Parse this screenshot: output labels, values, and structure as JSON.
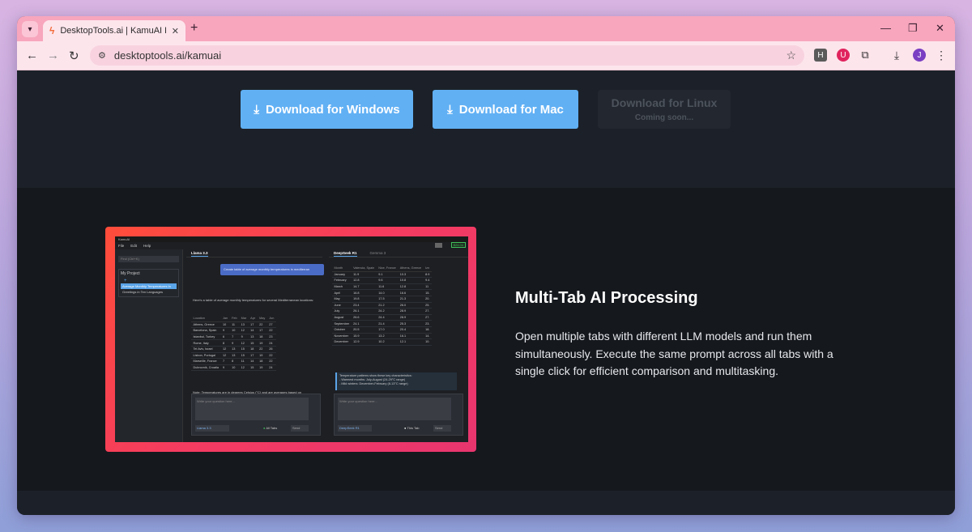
{
  "browser": {
    "tab_title": "DesktopTools.ai | KamuAI Privac",
    "url": "desktoptools.ai/kamuai",
    "profile_initial": "J",
    "ext_h": "H"
  },
  "downloads": {
    "windows": "Download for Windows",
    "mac": "Download for Mac",
    "linux": "Download for Linux",
    "linux_note": "Coming soon..."
  },
  "app": {
    "window_title": "KamuAI",
    "menu": [
      "File",
      "Edit",
      "Help"
    ],
    "find": "Find (Ctrl+K)",
    "project": "My Project",
    "items": [
      "Average Monthly Temperatures In",
      "Greetings in Ten Languages"
    ],
    "counter": "$24.04",
    "left_tabs": [
      "Llama 3.3"
    ],
    "right_tabs": [
      "DeepSeek R1",
      "Gemma 3"
    ],
    "prompt": "Create table of average monthly temperatures in mediterran",
    "intro": "Here's a table of average monthly temperatures for several Mediterranean locations:",
    "left_table": {
      "headers": [
        "Location",
        "Jan",
        "Feb",
        "Mar",
        "Apr",
        "May",
        "Jun"
      ],
      "rows": [
        [
          "Athens, Greece",
          "10",
          "11",
          "13",
          "17",
          "22",
          "27"
        ],
        [
          "Barcelona, Spain",
          "9",
          "10",
          "12",
          "14",
          "17",
          "22"
        ],
        [
          "Istanbul, Turkey",
          "6",
          "7",
          "9",
          "13",
          "18",
          "23"
        ],
        [
          "Rome, Italy",
          "8",
          "9",
          "12",
          "15",
          "19",
          "24"
        ],
        [
          "Tel Aviv, Israel",
          "12",
          "13",
          "15",
          "18",
          "22",
          "26"
        ],
        [
          "Lisbon, Portugal",
          "12",
          "13",
          "15",
          "17",
          "19",
          "22"
        ],
        [
          "Marseille, France",
          "7",
          "8",
          "11",
          "14",
          "18",
          "22"
        ],
        [
          "Dubrovnik, Croatia",
          "9",
          "10",
          "12",
          "15",
          "19",
          "24"
        ]
      ]
    },
    "left_note": "Note: Temperatures are in degrees Celsius (°C) and are averages based on",
    "right_table": {
      "headers": [
        "Month",
        "Valencia, Spain",
        "Nice, France",
        "Athens, Greece",
        "Izn"
      ],
      "rows": [
        [
          "January",
          "11.9",
          "9.1",
          "10.3",
          "8.9"
        ],
        [
          "February",
          "12.8",
          "9.6",
          "10.8",
          "9.4"
        ],
        [
          "March",
          "14.7",
          "11.6",
          "12.8",
          "11"
        ],
        [
          "April",
          "16.8",
          "14.0",
          "16.6",
          "15."
        ],
        [
          "May",
          "19.8",
          "17.5",
          "21.3",
          "20."
        ],
        [
          "June",
          "23.4",
          "21.2",
          "26.0",
          "25."
        ],
        [
          "July",
          "26.1",
          "24.2",
          "28.9",
          "27."
        ],
        [
          "August",
          "26.6",
          "24.4",
          "28.9",
          "27."
        ],
        [
          "September",
          "24.1",
          "21.4",
          "25.3",
          "23."
        ],
        [
          "October",
          "20.5",
          "17.0",
          "20.4",
          "18."
        ],
        [
          "November",
          "15.9",
          "13.2",
          "16.1",
          "14."
        ],
        [
          "December",
          "12.9",
          "10.2",
          "12.1",
          "10."
        ]
      ]
    },
    "right_note": [
      "Temperature patterns show these key characteristics:",
      "- Warmest months: July-August (24-29°C range)",
      "- Mild winters: December-February (8-13°C range)"
    ],
    "composer_placeholder": "Write your question here...",
    "left_model": "Llama 3.3",
    "right_model": "DeepSeek R1",
    "left_toggle": "All Tabs",
    "right_toggle": "This Tab",
    "send": "Send"
  },
  "feature": {
    "title": "Multi-Tab AI Processing",
    "description": "Open multiple tabs with different LLM models and run them simultaneously. Execute the same prompt across all tabs with a single click for efficient comparison and multitasking."
  },
  "colors": {
    "accent": "#61b0f4",
    "frame": "#f43b60"
  }
}
